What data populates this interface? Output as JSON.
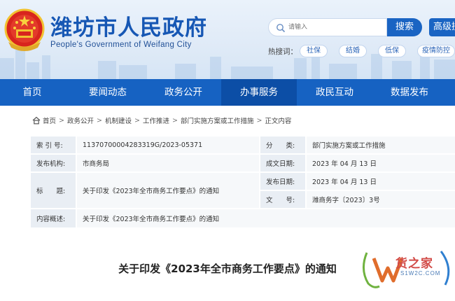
{
  "header": {
    "title": "潍坊市人民政府",
    "subtitle": "People's Government of Weifang City",
    "search_placeholder": "请输入",
    "search_label": "搜索",
    "advanced_label": "高级搜",
    "hot_label": "热搜词：",
    "hot_words": [
      "社保",
      "结婚",
      "低保",
      "疫情防控"
    ]
  },
  "nav": {
    "items": [
      "首页",
      "要闻动态",
      "政务公开",
      "办事服务",
      "政民互动",
      "数据发布"
    ],
    "active": "办事服务"
  },
  "breadcrumb": [
    "首页",
    "政务公开",
    "机制建设",
    "工作推进",
    "部门实施方案或工作措施",
    "正文内容"
  ],
  "info": {
    "index_label": "索 引 号:",
    "index_value": "11370700004283319G/2023-05371",
    "category_label": "分　　类:",
    "category_value": "部门实施方案或工作措施",
    "publisher_label": "发布机构:",
    "publisher_value": "市商务局",
    "created_label": "成文日期:",
    "created_value": "2023 年 04 月 13 日",
    "title_label": "标　　题:",
    "title_value": "关于印发《2023年全市商务工作要点》的通知",
    "published_label": "发布日期:",
    "published_value": "2023 年 04 月 13 日",
    "doc_label": "文　　号:",
    "doc_value": "潍商务字〔2023〕3号",
    "summary_label": "内容概述:",
    "summary_value": "关于印发《2023年全市商务工作要点》的通知"
  },
  "article": {
    "title": "关于印发《2023年全市商务工作要点》的通知"
  },
  "watermark": {
    "text": "货之家",
    "url": "S1W2C.COM"
  },
  "colors": {
    "primary": "#1662c2",
    "nav_active": "#0c4ea6",
    "title_blue": "#1657b4"
  }
}
